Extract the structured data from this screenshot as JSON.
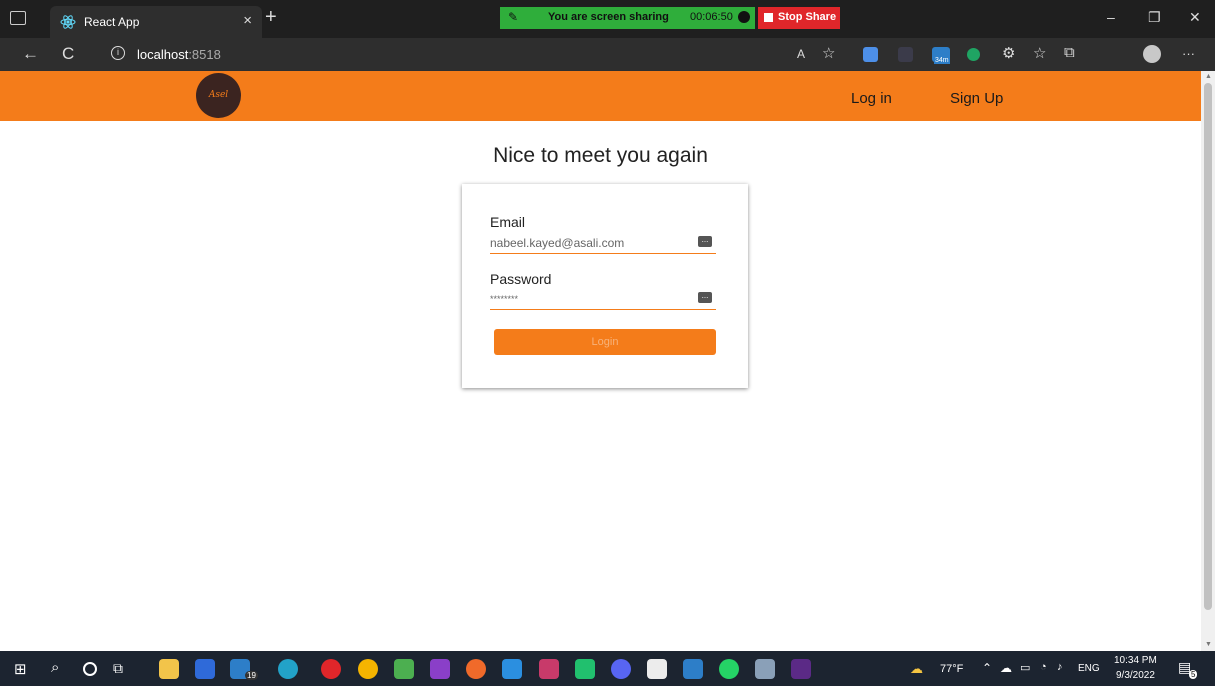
{
  "browser": {
    "tab_title": "React App",
    "tab_close": "×",
    "new_tab": "+",
    "share_message": "You are screen sharing",
    "share_timer": "00:06:50",
    "stop_share": "Stop Share",
    "minimize": "–",
    "restore": "❐",
    "close": "✕",
    "back": "←",
    "reload": "C",
    "url_host": "localhost",
    "url_port": ":8518",
    "read_aloud": "A",
    "favorite_add": "☆",
    "favorites": "☆",
    "collections": "⧉",
    "more": "···",
    "badge_34m": "34m"
  },
  "app": {
    "logo_text": "Asel",
    "nav": {
      "login": "Log in",
      "signup": "Sign Up"
    },
    "page_title": "Nice to meet you again",
    "form": {
      "email_label": "Email",
      "email_value": "nabeel.kayed@asali.com",
      "password_label": "Password",
      "password_value": "********",
      "login_button": "Login"
    }
  },
  "taskbar": {
    "temperature": "77°F",
    "language": "ENG",
    "time": "10:34 PM",
    "date": "9/3/2022",
    "mail_badge": "19",
    "notification_count": "5"
  },
  "colors": {
    "accent": "#f47c1a",
    "share_green": "#2fae3b",
    "share_red": "#e0262a",
    "taskbar": "#1c2430"
  }
}
